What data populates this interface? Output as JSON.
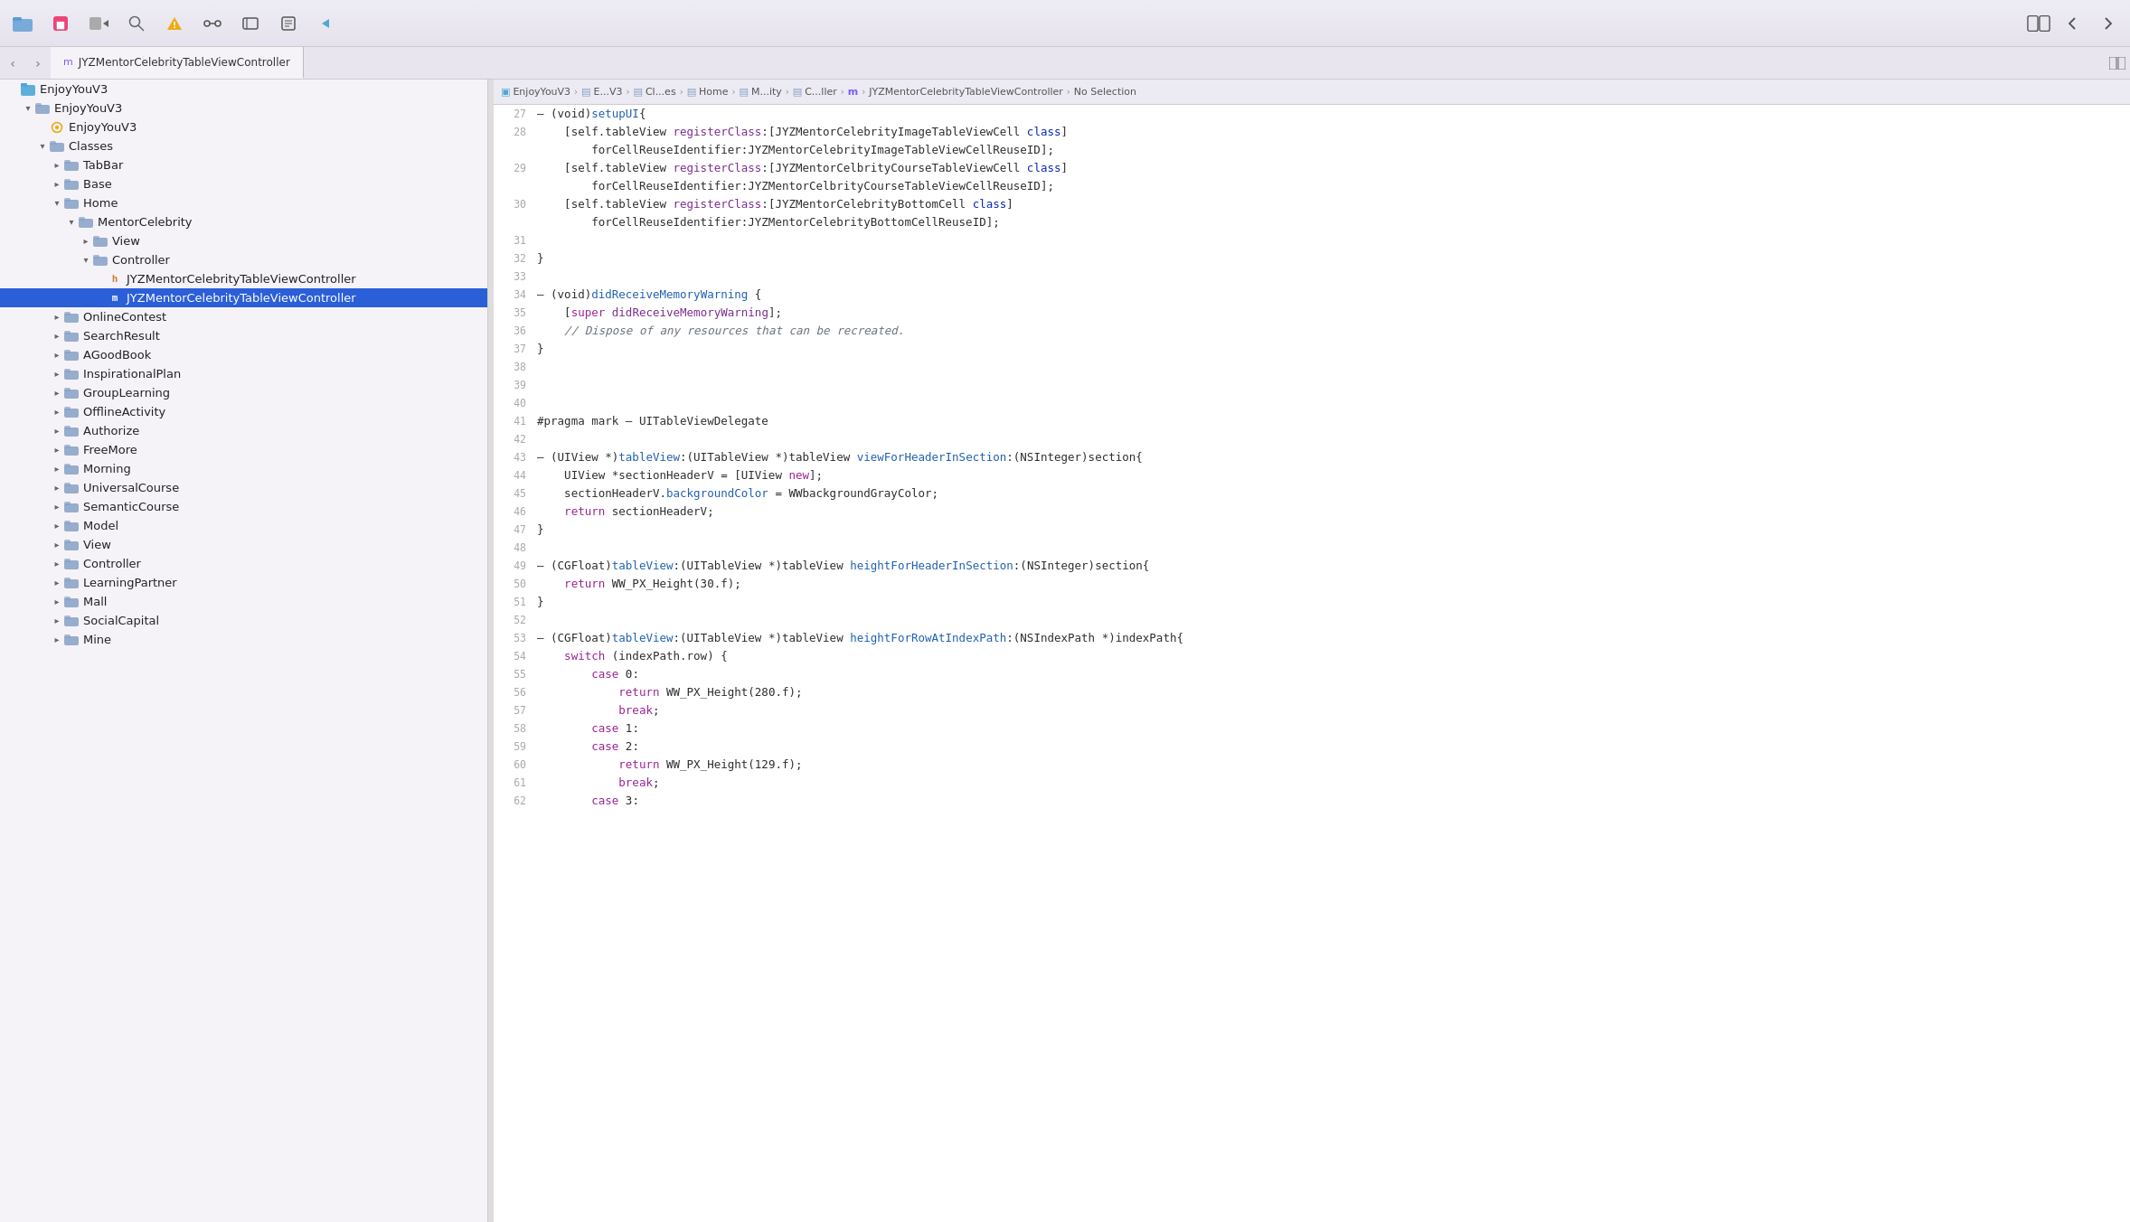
{
  "toolbar": {
    "icons": [
      "folder-icon",
      "stop-icon",
      "build-icon",
      "search-icon",
      "warning-icon",
      "source-icon",
      "git-icon",
      "snippet-icon",
      "breakpoint-icon"
    ],
    "right_icons": [
      "expand-icon",
      "back-icon",
      "forward-icon"
    ]
  },
  "active_tab": {
    "label": "JYZMentorCelebrityTableViewController",
    "icon": "m"
  },
  "breadcrumb": [
    {
      "icon": "project",
      "label": "EnjoyYouV3"
    },
    {
      "icon": "folder",
      "label": "E...V3"
    },
    {
      "icon": "folder",
      "label": "Cl...es"
    },
    {
      "icon": "folder",
      "label": "Home"
    },
    {
      "icon": "folder",
      "label": "M...ity"
    },
    {
      "icon": "folder",
      "label": "C...ller"
    },
    {
      "icon": "impl",
      "label": "m"
    },
    {
      "icon": "label",
      "label": "JYZMentorCelebrityTableViewController"
    },
    {
      "icon": "label",
      "label": "No Selection"
    }
  ],
  "sidebar": {
    "root_label": "EnjoyYouV3",
    "items": [
      {
        "id": "enjoyouv3-root",
        "label": "EnjoyYouV3",
        "indent": 0,
        "type": "project",
        "open": true
      },
      {
        "id": "enjoyouv3-folder",
        "label": "EnjoyYouV3",
        "indent": 1,
        "type": "folder",
        "open": true
      },
      {
        "id": "enjoyouv3-gear",
        "label": "EnjoyYouV3",
        "indent": 2,
        "type": "gear"
      },
      {
        "id": "classes",
        "label": "Classes",
        "indent": 2,
        "type": "folder",
        "open": true
      },
      {
        "id": "tabbar",
        "label": "TabBar",
        "indent": 3,
        "type": "folder",
        "open": false
      },
      {
        "id": "base",
        "label": "Base",
        "indent": 3,
        "type": "folder",
        "open": false
      },
      {
        "id": "home",
        "label": "Home",
        "indent": 3,
        "type": "folder",
        "open": true
      },
      {
        "id": "mentorcelebrity",
        "label": "MentorCelebrity",
        "indent": 4,
        "type": "folder",
        "open": true
      },
      {
        "id": "view",
        "label": "View",
        "indent": 5,
        "type": "folder",
        "open": false
      },
      {
        "id": "controller",
        "label": "Controller",
        "indent": 5,
        "type": "folder",
        "open": true
      },
      {
        "id": "jyz-header",
        "label": "JYZMentorCelebrityTableViewController",
        "indent": 6,
        "type": "header"
      },
      {
        "id": "jyz-impl",
        "label": "JYZMentorCelebrityTableViewController",
        "indent": 6,
        "type": "impl",
        "selected": true
      },
      {
        "id": "onlinecontest",
        "label": "OnlineContest",
        "indent": 3,
        "type": "folder",
        "open": false
      },
      {
        "id": "searchresult",
        "label": "SearchResult",
        "indent": 3,
        "type": "folder",
        "open": false
      },
      {
        "id": "agoodbook",
        "label": "AGoodBook",
        "indent": 3,
        "type": "folder",
        "open": false
      },
      {
        "id": "inspirationalplan",
        "label": "InspirationalPlan",
        "indent": 3,
        "type": "folder",
        "open": false
      },
      {
        "id": "grouplearning",
        "label": "GroupLearning",
        "indent": 3,
        "type": "folder",
        "open": false
      },
      {
        "id": "offlineactivity",
        "label": "OfflineActivity",
        "indent": 3,
        "type": "folder",
        "open": false
      },
      {
        "id": "authorize",
        "label": "Authorize",
        "indent": 3,
        "type": "folder",
        "open": false
      },
      {
        "id": "freemore",
        "label": "FreeMore",
        "indent": 3,
        "type": "folder",
        "open": false
      },
      {
        "id": "morning",
        "label": "Morning",
        "indent": 3,
        "type": "folder",
        "open": false
      },
      {
        "id": "universalcourse",
        "label": "UniversalCourse",
        "indent": 3,
        "type": "folder",
        "open": false
      },
      {
        "id": "semanticcourse",
        "label": "SemanticCourse",
        "indent": 3,
        "type": "folder",
        "open": false
      },
      {
        "id": "model",
        "label": "Model",
        "indent": 3,
        "type": "folder",
        "open": false
      },
      {
        "id": "view2",
        "label": "View",
        "indent": 3,
        "type": "folder",
        "open": false
      },
      {
        "id": "controller2",
        "label": "Controller",
        "indent": 3,
        "type": "folder",
        "open": false
      },
      {
        "id": "learningpartner",
        "label": "LearningPartner",
        "indent": 3,
        "type": "folder",
        "open": false
      },
      {
        "id": "mall",
        "label": "Mall",
        "indent": 3,
        "type": "folder",
        "open": false
      },
      {
        "id": "socialcapital",
        "label": "SocialCapital",
        "indent": 3,
        "type": "folder",
        "open": false
      },
      {
        "id": "mine",
        "label": "Mine",
        "indent": 3,
        "type": "folder",
        "open": false
      }
    ]
  },
  "code": {
    "lines": [
      {
        "num": 27,
        "tokens": [
          {
            "t": "– (void)",
            "c": "plain"
          },
          {
            "t": "setupUI",
            "c": "method-blue"
          },
          {
            "t": "{",
            "c": "plain"
          }
        ]
      },
      {
        "num": 28,
        "tokens": [
          {
            "t": "    [self.tableView ",
            "c": "plain"
          },
          {
            "t": "registerClass",
            "c": "method-purple"
          },
          {
            "t": ":[JYZMentorCelebrityImageTableViewCell ",
            "c": "plain"
          },
          {
            "t": "class",
            "c": "kw-blue"
          },
          {
            "t": "]",
            "c": "plain"
          }
        ]
      },
      {
        "num": "",
        "tokens": [
          {
            "t": "        forCellReuseIdentifier:JYZMentorCelebrityImageTableViewCellReuseID];",
            "c": "plain"
          }
        ]
      },
      {
        "num": 29,
        "tokens": [
          {
            "t": "    [self.tableView ",
            "c": "plain"
          },
          {
            "t": "registerClass",
            "c": "method-purple"
          },
          {
            "t": ":[JYZMentorCelbrityCourseTableViewCell ",
            "c": "plain"
          },
          {
            "t": "class",
            "c": "kw-blue"
          },
          {
            "t": "]",
            "c": "plain"
          }
        ]
      },
      {
        "num": "",
        "tokens": [
          {
            "t": "        forCellReuseIdentifier:JYZMentorCelbrityCourseTableViewCellReuseID];",
            "c": "plain"
          }
        ]
      },
      {
        "num": 30,
        "tokens": [
          {
            "t": "    [self.tableView ",
            "c": "plain"
          },
          {
            "t": "registerClass",
            "c": "method-purple"
          },
          {
            "t": ":[JYZMentorCelebrityBottomCell ",
            "c": "plain"
          },
          {
            "t": "class",
            "c": "kw-blue"
          },
          {
            "t": "]",
            "c": "plain"
          }
        ]
      },
      {
        "num": "",
        "tokens": [
          {
            "t": "        forCellReuseIdentifier:JYZMentorCelebrityBottomCellReuseID];",
            "c": "plain"
          }
        ]
      },
      {
        "num": 31,
        "tokens": []
      },
      {
        "num": 32,
        "tokens": [
          {
            "t": "}",
            "c": "plain"
          }
        ]
      },
      {
        "num": 33,
        "tokens": []
      },
      {
        "num": 34,
        "tokens": [
          {
            "t": "– (void)",
            "c": "plain"
          },
          {
            "t": "didReceiveMemoryWarning",
            "c": "method-blue"
          },
          {
            "t": " {",
            "c": "plain"
          }
        ]
      },
      {
        "num": 35,
        "tokens": [
          {
            "t": "    [",
            "c": "plain"
          },
          {
            "t": "super",
            "c": "kw-purple"
          },
          {
            "t": " ",
            "c": "plain"
          },
          {
            "t": "didReceiveMemoryWarning",
            "c": "method-purple"
          },
          {
            "t": "];",
            "c": "plain"
          }
        ]
      },
      {
        "num": 36,
        "tokens": [
          {
            "t": "    ",
            "c": "plain"
          },
          {
            "t": "// Dispose of any resources that can be recreated.",
            "c": "comment"
          }
        ]
      },
      {
        "num": 37,
        "tokens": [
          {
            "t": "}",
            "c": "plain"
          }
        ]
      },
      {
        "num": 38,
        "tokens": []
      },
      {
        "num": 39,
        "tokens": []
      },
      {
        "num": 40,
        "tokens": []
      },
      {
        "num": 41,
        "tokens": [
          {
            "t": "#pragma mark",
            "c": "plain"
          },
          {
            "t": " – UITableViewDelegate",
            "c": "plain"
          }
        ]
      },
      {
        "num": 42,
        "tokens": []
      },
      {
        "num": 43,
        "tokens": [
          {
            "t": "– (UIView *)",
            "c": "plain"
          },
          {
            "t": "tableView",
            "c": "method-blue"
          },
          {
            "t": ":(UITableView *)tableView ",
            "c": "plain"
          },
          {
            "t": "viewForHeaderInSection",
            "c": "method-blue"
          },
          {
            "t": ":(NSInteger)section{",
            "c": "plain"
          }
        ]
      },
      {
        "num": 44,
        "tokens": [
          {
            "t": "    UIView *sectionHeaderV = [UIView ",
            "c": "plain"
          },
          {
            "t": "new",
            "c": "kw-purple"
          },
          {
            "t": "];",
            "c": "plain"
          }
        ]
      },
      {
        "num": 45,
        "tokens": [
          {
            "t": "    sectionHeaderV.",
            "c": "plain"
          },
          {
            "t": "backgroundColor",
            "c": "method-blue"
          },
          {
            "t": " = WWbackgroundGrayColor;",
            "c": "plain"
          }
        ]
      },
      {
        "num": 46,
        "tokens": [
          {
            "t": "    ",
            "c": "plain"
          },
          {
            "t": "return",
            "c": "kw-purple"
          },
          {
            "t": " sectionHeaderV;",
            "c": "plain"
          }
        ]
      },
      {
        "num": 47,
        "tokens": [
          {
            "t": "}",
            "c": "plain"
          }
        ]
      },
      {
        "num": 48,
        "tokens": []
      },
      {
        "num": 49,
        "tokens": [
          {
            "t": "– (CGFloat)",
            "c": "plain"
          },
          {
            "t": "tableView",
            "c": "method-blue"
          },
          {
            "t": ":(UITableView *)tableView ",
            "c": "plain"
          },
          {
            "t": "heightForHeaderInSection",
            "c": "method-blue"
          },
          {
            "t": ":(NSInteger)section{",
            "c": "plain"
          }
        ]
      },
      {
        "num": 50,
        "tokens": [
          {
            "t": "    ",
            "c": "plain"
          },
          {
            "t": "return",
            "c": "kw-purple"
          },
          {
            "t": " WW_PX_Height(30.f);",
            "c": "plain"
          }
        ]
      },
      {
        "num": 51,
        "tokens": [
          {
            "t": "}",
            "c": "plain"
          }
        ]
      },
      {
        "num": 52,
        "tokens": []
      },
      {
        "num": 53,
        "tokens": [
          {
            "t": "– (CGFloat)",
            "c": "plain"
          },
          {
            "t": "tableView",
            "c": "method-blue"
          },
          {
            "t": ":(UITableView *)tableView ",
            "c": "plain"
          },
          {
            "t": "heightForRowAtIndexPath",
            "c": "method-blue"
          },
          {
            "t": ":(NSIndexPath *)indexPath{",
            "c": "plain"
          }
        ]
      },
      {
        "num": 54,
        "tokens": [
          {
            "t": "    ",
            "c": "plain"
          },
          {
            "t": "switch",
            "c": "kw-purple"
          },
          {
            "t": " (indexPath.row) {",
            "c": "plain"
          }
        ]
      },
      {
        "num": 55,
        "tokens": [
          {
            "t": "        ",
            "c": "plain"
          },
          {
            "t": "case",
            "c": "kw-purple"
          },
          {
            "t": " 0:",
            "c": "plain"
          }
        ]
      },
      {
        "num": 56,
        "tokens": [
          {
            "t": "            ",
            "c": "plain"
          },
          {
            "t": "return",
            "c": "kw-purple"
          },
          {
            "t": " WW_PX_Height(280.f);",
            "c": "plain"
          }
        ]
      },
      {
        "num": 57,
        "tokens": [
          {
            "t": "            ",
            "c": "plain"
          },
          {
            "t": "break",
            "c": "kw-purple"
          },
          {
            "t": ";",
            "c": "plain"
          }
        ]
      },
      {
        "num": 58,
        "tokens": [
          {
            "t": "        ",
            "c": "plain"
          },
          {
            "t": "case",
            "c": "kw-purple"
          },
          {
            "t": " 1:",
            "c": "plain"
          }
        ]
      },
      {
        "num": 59,
        "tokens": [
          {
            "t": "        ",
            "c": "plain"
          },
          {
            "t": "case",
            "c": "kw-purple"
          },
          {
            "t": " 2:",
            "c": "plain"
          }
        ]
      },
      {
        "num": 60,
        "tokens": [
          {
            "t": "            ",
            "c": "plain"
          },
          {
            "t": "return",
            "c": "kw-purple"
          },
          {
            "t": " WW_PX_Height(129.f);",
            "c": "plain"
          }
        ]
      },
      {
        "num": 61,
        "tokens": [
          {
            "t": "            ",
            "c": "plain"
          },
          {
            "t": "break",
            "c": "kw-purple"
          },
          {
            "t": ";",
            "c": "plain"
          }
        ]
      },
      {
        "num": 62,
        "tokens": [
          {
            "t": "        ",
            "c": "plain"
          },
          {
            "t": "case",
            "c": "kw-purple"
          },
          {
            "t": " 3:",
            "c": "plain"
          }
        ]
      }
    ]
  }
}
